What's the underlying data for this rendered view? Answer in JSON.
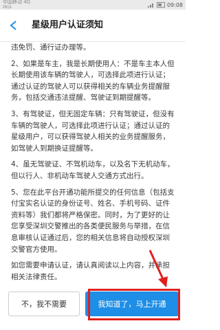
{
  "status_bar": {
    "carrier": "中国移动 4G",
    "speed": "0K/s",
    "time": "09:08"
  },
  "header": {
    "title": "星级用户认证须知",
    "back_icon": "back-arrow-icon"
  },
  "content": {
    "paragraphs": [
      "违免罚、通行证办理等。",
      "2、如果是车主，我是长期使用人：不是车主本人但长期使用该车辆的驾驶人，可选择此项进行认证；通过认证的驾驶人可以获得相关的车辆业务提醒服务，包括交通违法提醒、驾驶证到期提醒等。",
      "3、有驾驶证，但无固定车辆：只有驾驶证，但没有车辆的驾驶人，可选择此项进行认证；通过认证的星级用户，可以获得驾驶人相关的业务提醒服务，如驾驶人到期换证提醒等。",
      "4、虽无驾驶证、不驾机动车，以及名下无机动车，但以行人、非机动车驾驶人交通方式出行。",
      "5、您在此平台开通功能所提交的任何信息（包括支付宝实名认证的身份证号、姓名、手机号码、证件资料等）我们都将严格保密。同时，为了更好的让您享受深圳交警推出的各类便民服务与举措，在信息审核认证通过后，您的相关信息将自动授权深圳交警官方使用。",
      "如您需要申请认证，请认真阅读以上内容，并承担相关法律责任。"
    ]
  },
  "footer": {
    "decline_label": "不，我不需要",
    "accept_label": "我知道了，马上开通"
  },
  "colors": {
    "accent": "#1e8ee6",
    "annotation": "#e0201e"
  }
}
